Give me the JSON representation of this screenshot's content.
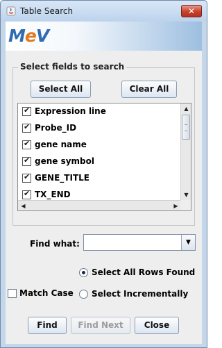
{
  "window": {
    "title": "Table Search",
    "close_label": "✕"
  },
  "logo": {
    "text_pre": "M",
    "text_e": "e",
    "text_post": "V"
  },
  "fields_group": {
    "legend": "Select fields to search",
    "select_all_label": "Select All",
    "clear_all_label": "Clear All",
    "items": [
      {
        "label": "Expression line",
        "checked": true
      },
      {
        "label": "Probe_ID",
        "checked": true
      },
      {
        "label": "gene name",
        "checked": true
      },
      {
        "label": "gene symbol",
        "checked": true
      },
      {
        "label": "GENE_TITLE",
        "checked": true
      },
      {
        "label": "TX_END",
        "checked": true
      }
    ]
  },
  "search": {
    "find_what_label": "Find what:",
    "find_what_value": ""
  },
  "options": {
    "select_all_rows_label": "Select All Rows Found",
    "select_incrementally_label": "Select Incrementally",
    "match_case_label": "Match Case",
    "selected_mode": "select_all_rows",
    "match_case": false
  },
  "buttons": {
    "find": "Find",
    "find_next": "Find Next",
    "close": "Close"
  }
}
